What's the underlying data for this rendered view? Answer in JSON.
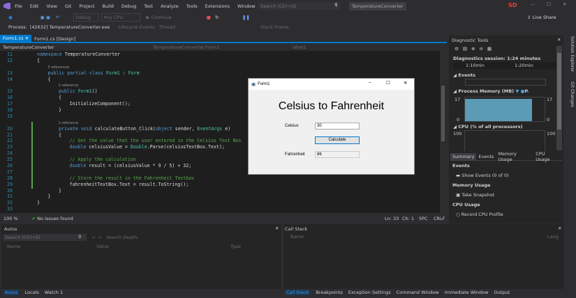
{
  "title_bar": {
    "menu": [
      "File",
      "Edit",
      "View",
      "Git",
      "Project",
      "Build",
      "Debug",
      "Test",
      "Analyze",
      "Tools",
      "Extensions",
      "Window",
      "Help"
    ],
    "search_placeholder": "Search (Ctrl+Q)",
    "solution_name": "TemperatureConverter",
    "avatar": "SD",
    "live_share": "Live Share"
  },
  "toolbar": {
    "config": "Debug",
    "platform": "Any CPU",
    "continue": "Continue",
    "stack_frame": "Stack Frame:"
  },
  "process_bar": {
    "label": "Process:",
    "process": "[42632] TemperatureConverter.exe",
    "lifecycle": "Lifecycle Events",
    "thread": "Thread:"
  },
  "editor": {
    "tabs": [
      {
        "label": "Form1.cs",
        "active": true
      },
      {
        "label": "Form1.cs [Design]",
        "active": false
      }
    ],
    "nav": {
      "project": "TemperatureConverter",
      "class": "TemperatureConverter.Form1",
      "member": "label1"
    },
    "lines": [
      {
        "n": "11",
        "t": [
          [
            "namespace ",
            "kw"
          ],
          [
            "TemperatureConverter",
            "id"
          ]
        ],
        "i": 0
      },
      {
        "n": "12",
        "t": [
          [
            "{",
            "id"
          ]
        ],
        "i": 0
      },
      {
        "lens": "3 references",
        "i": 1
      },
      {
        "n": "13",
        "t": [
          [
            "public partial class ",
            "kw"
          ],
          [
            "Form1",
            "ty"
          ],
          [
            " : ",
            "id"
          ],
          [
            "Form",
            "ty"
          ]
        ],
        "i": 1
      },
      {
        "n": "14",
        "t": [
          [
            "{",
            "id"
          ]
        ],
        "i": 1
      },
      {
        "lens": "1 reference",
        "i": 2
      },
      {
        "n": "15",
        "t": [
          [
            "public ",
            "kw"
          ],
          [
            "Form1",
            "ty"
          ],
          [
            "()",
            "id"
          ]
        ],
        "i": 2
      },
      {
        "n": "16",
        "t": [
          [
            "{",
            "id"
          ]
        ],
        "i": 2
      },
      {
        "n": "17",
        "t": [
          [
            "InitializeComponent();",
            "id"
          ]
        ],
        "i": 3
      },
      {
        "n": "18",
        "t": [
          [
            "}",
            "id"
          ]
        ],
        "i": 2
      },
      {
        "n": "19",
        "t": [],
        "i": 0
      },
      {
        "lens": "1 reference",
        "i": 2
      },
      {
        "n": "20",
        "t": [
          [
            "private void ",
            "kw"
          ],
          [
            "calculateButton_Click(",
            "id"
          ],
          [
            "object ",
            "kw"
          ],
          [
            "sender, ",
            "id"
          ],
          [
            "EventArgs ",
            "ty"
          ],
          [
            "e)",
            "id"
          ]
        ],
        "i": 2
      },
      {
        "n": "21",
        "t": [
          [
            "{",
            "id"
          ]
        ],
        "i": 2
      },
      {
        "n": "22",
        "t": [
          [
            "// Get the value that the user entered in the Celsius Text Box",
            "cm"
          ]
        ],
        "i": 3
      },
      {
        "n": "23",
        "t": [
          [
            "double ",
            "kw"
          ],
          [
            "celsiusValue = ",
            "id"
          ],
          [
            "Double",
            "ty"
          ],
          [
            ".Parse(celsiusTextBox.Text);",
            "id"
          ]
        ],
        "i": 3
      },
      {
        "n": "24",
        "t": [],
        "i": 0
      },
      {
        "n": "25",
        "t": [
          [
            "// Apply the calculation",
            "cm"
          ]
        ],
        "i": 3
      },
      {
        "n": "26",
        "t": [
          [
            "double ",
            "kw"
          ],
          [
            "result = (celsiusValue * 9 / 5) + 32;",
            "id"
          ]
        ],
        "i": 3
      },
      {
        "n": "27",
        "t": [],
        "i": 0
      },
      {
        "n": "28",
        "t": [
          [
            "// Store the result in the Fahrenheit Textbox",
            "cm"
          ]
        ],
        "i": 3
      },
      {
        "n": "29",
        "t": [
          [
            "fahrenheitTextBox.Text = result.ToString();",
            "id"
          ]
        ],
        "i": 3
      },
      {
        "n": "30",
        "t": [
          [
            "}",
            "id"
          ]
        ],
        "i": 2
      },
      {
        "n": "31",
        "t": [
          [
            "}",
            "id"
          ]
        ],
        "i": 1
      },
      {
        "n": "32",
        "t": [
          [
            "}",
            "id"
          ]
        ],
        "i": 0
      },
      {
        "n": "33",
        "t": [],
        "i": 0
      }
    ],
    "status": {
      "zoom": "100 %",
      "issues": "No issues found",
      "ln": "Ln: 33",
      "ch": "Ch: 1",
      "spc": "SPC",
      "crlf": "CRLF"
    }
  },
  "form": {
    "title": "Form1",
    "heading": "Celsius to Fahrenheit",
    "celsius_label": "Celsius",
    "celsius_value": "30",
    "button": "Calculate",
    "fahrenheit_label": "Fahrenheit",
    "fahrenheit_value": "86"
  },
  "diagnostics": {
    "title": "Diagnostic Tools",
    "session": "Diagnostics session: 1:24 minutes",
    "t1": "1:10min",
    "t2": "1:20min",
    "events": "Events",
    "memory": "Process Memory (MB)",
    "mem_legend": "P.",
    "mem_max": "17",
    "mem_min": "0",
    "cpu": "CPU (% of all processors)",
    "cpu_max": "100",
    "tabs": [
      "Summary",
      "Events",
      "Memory Usage",
      "CPU Usage"
    ],
    "sec_events": "Events",
    "show_events": "Show Events (0 of 0)",
    "sec_memory": "Memory Usage",
    "snapshot": "Take Snapshot",
    "sec_cpu": "CPU Usage",
    "record_cpu": "Record CPU Profile",
    "accent": "#5b9bb5"
  },
  "side_tabs": [
    "Solution Explorer",
    "Git Changes"
  ],
  "autos": {
    "title": "Autos",
    "search_placeholder": "Search (Ctrl+E)",
    "search_depth": "Search Depth:",
    "cols": [
      "Name",
      "Value",
      "Type"
    ],
    "tabs": [
      "Autos",
      "Locals",
      "Watch 1"
    ]
  },
  "callstack": {
    "title": "Call Stack",
    "cols": [
      "Name",
      "Lang"
    ],
    "tabs": [
      "Call Stack",
      "Breakpoints",
      "Exception Settings",
      "Command Window",
      "Immediate Window",
      "Output"
    ]
  }
}
